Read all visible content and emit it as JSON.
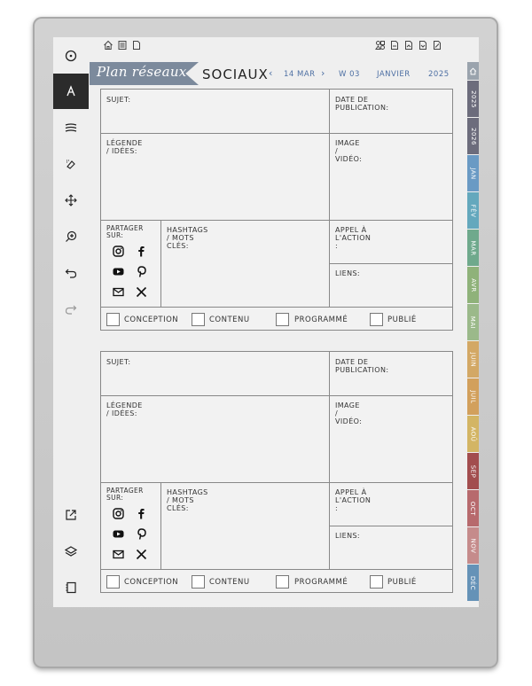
{
  "header": {
    "ribbon_title": "Plan réseaux",
    "title": "SOCIAUX",
    "nav_prev": "‹",
    "date": "14 MAR",
    "nav_next": "›",
    "week": "W 03",
    "month": "JANVIER",
    "year": "2025"
  },
  "sidebar_tabs": [
    {
      "label": "2025",
      "color": "#6c6c7c"
    },
    {
      "label": "2026",
      "color": "#6c6c7c"
    },
    {
      "label": "JAN",
      "color": "#6a9ac4"
    },
    {
      "label": "FÉV",
      "color": "#64a8bd"
    },
    {
      "label": "MAR",
      "color": "#6fa98c"
    },
    {
      "label": "AVR",
      "color": "#8fb27a"
    },
    {
      "label": "MAI",
      "color": "#9bb98a"
    },
    {
      "label": "JUIN",
      "color": "#d3a865"
    },
    {
      "label": "JUIL",
      "color": "#d2a05c"
    },
    {
      "label": "AOÛ",
      "color": "#d3b564"
    },
    {
      "label": "SEP",
      "color": "#a24d4e"
    },
    {
      "label": "OCT",
      "color": "#b76a6d"
    },
    {
      "label": "NOV",
      "color": "#c58b8b"
    },
    {
      "label": "DÉC",
      "color": "#6592b7"
    }
  ],
  "forms": [
    {
      "subject_label": "SUJET:",
      "pub_date_label": "DATE DE PUBLICATION:",
      "caption_label": "LÉGENDE / IDÉES:",
      "media_label": "IMAGE / VIDÉO:",
      "share_label": "PARTAGER SUR:",
      "hashtags_label": "HASHTAGS / MOTS CLÉS:",
      "cta_label": "APPEL À L'ACTION :",
      "links_label": "LIENS:",
      "checkboxes": [
        "CONCEPTION",
        "CONTENU",
        "PROGRAMMÉ",
        "PUBLIÉ"
      ]
    },
    {
      "subject_label": "SUJET:",
      "pub_date_label": "DATE DE PUBLICATION:",
      "caption_label": "LÉGENDE / IDÉES:",
      "media_label": "IMAGE / VIDÉO:",
      "share_label": "PARTAGER SUR:",
      "hashtags_label": "HASHTAGS / MOTS CLÉS:",
      "cta_label": "APPEL À L'ACTION :",
      "links_label": "LIENS:",
      "checkboxes": [
        "CONCEPTION",
        "CONTENU",
        "PROGRAMMÉ",
        "PUBLIÉ"
      ]
    }
  ],
  "toolbar_icons": [
    "circle-dot-icon",
    "pen-icon",
    "lines-icon",
    "eraser-icon",
    "move-icon",
    "zoom-icon",
    "undo-icon",
    "redo-icon",
    "share-icon",
    "layers-icon",
    "page-icon"
  ],
  "top_icons_left": [
    "home-icon",
    "list-icon",
    "page-icon"
  ],
  "top_icons_right": [
    "shapes-icon",
    "doc1-icon",
    "doc2-icon",
    "doc3-icon",
    "doc4-icon"
  ]
}
